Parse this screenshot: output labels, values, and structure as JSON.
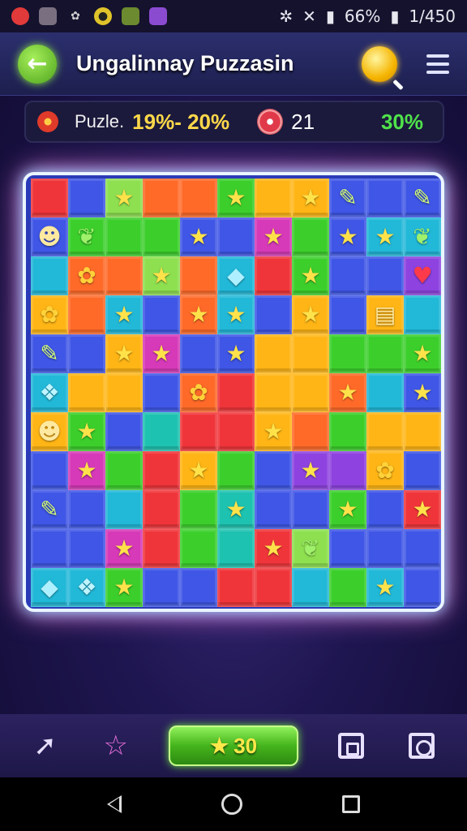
{
  "status_bar": {
    "battery": "66%",
    "time": "1/450"
  },
  "header": {
    "title": "Ungalinnay Puzzasin"
  },
  "score_bar": {
    "label": "Puzle.",
    "score_pct": "19%- 20%",
    "moves": "21",
    "progress": "30%"
  },
  "board": {
    "rows": [
      [
        "R",
        "B",
        "L",
        "O",
        "O",
        "G",
        "Y",
        "Y",
        "B",
        "B",
        "B"
      ],
      [
        "B",
        "G",
        "G",
        "G",
        "B",
        "B",
        "M",
        "G",
        "B",
        "C",
        "C"
      ],
      [
        "C",
        "O",
        "O",
        "L",
        "O",
        "C",
        "R",
        "G",
        "B",
        "B",
        "P"
      ],
      [
        "Y",
        "O",
        "C",
        "B",
        "O",
        "C",
        "B",
        "Y",
        "B",
        "Y",
        "C"
      ],
      [
        "B",
        "B",
        "Y",
        "M",
        "B",
        "B",
        "Y",
        "Y",
        "G",
        "G",
        "G"
      ],
      [
        "C",
        "Y",
        "Y",
        "B",
        "O",
        "R",
        "Y",
        "Y",
        "O",
        "C",
        "B"
      ],
      [
        "Y",
        "G",
        "B",
        "T",
        "R",
        "R",
        "Y",
        "O",
        "G",
        "Y",
        "Y"
      ],
      [
        "B",
        "M",
        "G",
        "R",
        "Y",
        "G",
        "B",
        "P",
        "P",
        "Y",
        "B"
      ],
      [
        "B",
        "B",
        "C",
        "R",
        "G",
        "T",
        "B",
        "B",
        "G",
        "B",
        "R"
      ],
      [
        "B",
        "B",
        "M",
        "R",
        "G",
        "T",
        "R",
        "L",
        "B",
        "B",
        "B"
      ],
      [
        "C",
        "C",
        "G",
        "B",
        "B",
        "R",
        "R",
        "C",
        "G",
        "C",
        "B"
      ]
    ],
    "icons": [
      [
        "",
        "",
        "star",
        "",
        "",
        "star",
        "",
        "star",
        "pencil",
        "",
        "pencil"
      ],
      [
        "face",
        "leaf",
        "",
        "",
        "star",
        "",
        "star",
        "",
        "star",
        "star",
        "leaf"
      ],
      [
        "",
        "blob",
        "",
        "star",
        "",
        "gem",
        "",
        "star",
        "",
        "",
        "heart"
      ],
      [
        "blob",
        "",
        "star",
        "",
        "star",
        "star",
        "",
        "star",
        "",
        "card",
        ""
      ],
      [
        "pencil",
        "",
        "star",
        "star",
        "",
        "star",
        "",
        "",
        "",
        "",
        "star"
      ],
      [
        "drop",
        "",
        "",
        "",
        "blob",
        "",
        "",
        "",
        "star",
        "",
        "star"
      ],
      [
        "face",
        "star",
        "",
        "",
        "",
        "",
        "star",
        "",
        "",
        "",
        ""
      ],
      [
        "",
        "star",
        "",
        "",
        "star",
        "",
        "",
        "star",
        "",
        "blob",
        ""
      ],
      [
        "pencil",
        "",
        "",
        "",
        "",
        "star",
        "",
        "",
        "star",
        "",
        "star"
      ],
      [
        "",
        "",
        "star",
        "",
        "",
        "",
        "star",
        "leaf",
        "",
        "",
        ""
      ],
      [
        "gem",
        "drop",
        "star",
        "",
        "",
        "",
        "",
        "",
        "",
        "star",
        ""
      ]
    ]
  },
  "bottom_bar": {
    "boost_value": "30",
    "boost_star": "★"
  }
}
